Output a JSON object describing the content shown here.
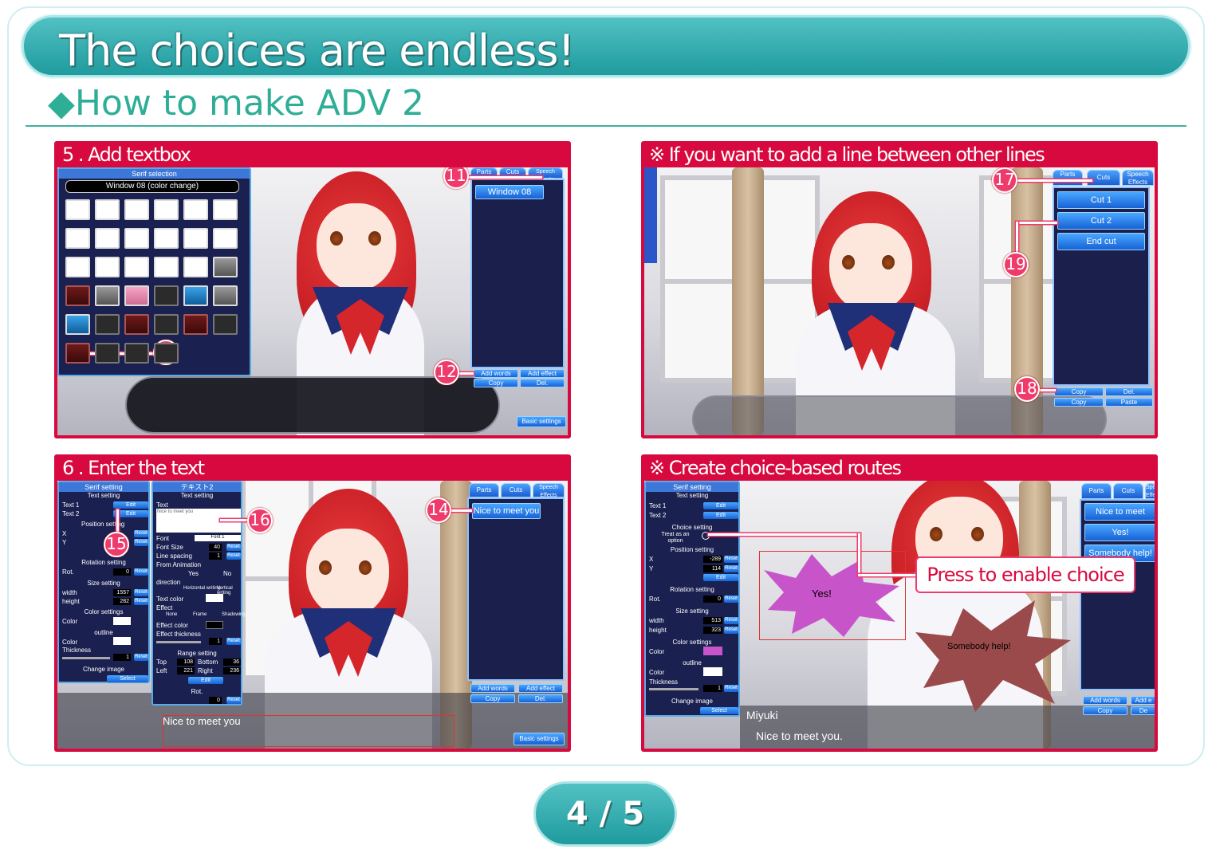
{
  "banner": {
    "title": "The choices are endless!"
  },
  "subheading": "◆How to make ADV 2",
  "panels": {
    "p1": {
      "title": "5 . Add textbox",
      "selector_header": "Serif selection",
      "window_name": "Window 08 (color change)",
      "list_item": "Window 08",
      "tabs": [
        "Parts",
        "Cuts",
        "Speech Effects"
      ],
      "buttons": {
        "add_words": "Add words",
        "add_effect": "Add effect",
        "copy": "Copy",
        "del": "Del.",
        "basic": "Basic settings"
      },
      "callouts": [
        "11",
        "12",
        "13"
      ]
    },
    "p2": {
      "title": "※ If you want to add a line between other lines",
      "tabs": [
        "Parts",
        "Cuts",
        "Speech Effects"
      ],
      "list": [
        "Cut 1",
        "Cut 2",
        "End cut"
      ],
      "buttons": {
        "copy": "Copy",
        "del": "Del.",
        "copy2": "Copy",
        "paste": "Paste"
      },
      "callouts": [
        "17",
        "18",
        "19"
      ]
    },
    "p3": {
      "title": "6 . Enter the text",
      "serif_header": "Serif setting",
      "text2_header": "テキスト2",
      "text_setting": "Text setting",
      "text1": "Text 1",
      "text2": "Text 2",
      "edit": "Edit",
      "reset": "Reset",
      "select": "Select",
      "position": "Position setting",
      "x": "X",
      "y": "Y",
      "rotation": "Rotation setting",
      "rot": "Rot.",
      "size": "Size setting",
      "width": "width",
      "height": "height",
      "width_val": "1557",
      "height_val": "282",
      "color_settings": "Color settings",
      "color": "Color",
      "outline": "outline",
      "thickness": "Thickness",
      "change_image": "Change image",
      "text_label": "Text",
      "text_value": "Nice to meet you",
      "font": "Font",
      "font_value": "Font 1",
      "font_size": "Font Size",
      "font_size_val": "40",
      "line_spacing": "Line spacing",
      "line_spacing_val": "1",
      "from_animation": "From Animation",
      "yes": "Yes",
      "no": "No",
      "direction": "direction",
      "horizontal": "Horizontal writing",
      "vertical": "Vertical writing",
      "text_color": "Text color",
      "effect": "Effect",
      "none": "None",
      "frame": "Frame",
      "shadowing": "Shadowing",
      "effect_color": "Effect color",
      "effect_thickness": "Effect thickness",
      "effect_thickness_val": "1",
      "range": "Range setting",
      "top": "Top",
      "top_val": "108",
      "bottom": "Bottom",
      "bottom_val": "36",
      "left": "Left",
      "left_val": "221",
      "right": "Right",
      "right_val": "236",
      "rot_val": "0",
      "thickness_val": "1",
      "tabs": [
        "Parts",
        "Cuts",
        "Speech Effects"
      ],
      "list_item": "Nice to meet you",
      "buttons": {
        "add_words": "Add words",
        "add_effect": "Add effect",
        "copy": "Copy",
        "del": "Del.",
        "basic": "Basic settings"
      },
      "speaker": "???",
      "dialog": "Nice to meet you",
      "callouts": [
        "14",
        "15",
        "16"
      ]
    },
    "p4": {
      "title": "※ Create choice-based routes",
      "serif_header": "Serif setting",
      "text_setting": "Text setting",
      "text1": "Text 1",
      "text2": "Text 2",
      "edit": "Edit",
      "choice_setting": "Choice setting",
      "treat_as_option": "Treat as an option",
      "position": "Position setting",
      "x": "X",
      "y": "Y",
      "x_val": "-289",
      "y_val": "114",
      "rotation": "Rotation setting",
      "rot": "Rot.",
      "rot_val": "0",
      "size": "Size setting",
      "width": "width",
      "height": "height",
      "width_val": "513",
      "height_val": "323",
      "color_settings": "Color settings",
      "color": "Color",
      "outline": "outline",
      "thickness": "Thickness",
      "thickness_val": "1",
      "change_image": "Change image",
      "select": "Select",
      "reset": "Reset",
      "tabs": [
        "Parts",
        "Cuts",
        "Speech Effects"
      ],
      "list": [
        "Nice to meet",
        "Yes!",
        "Somebody help!"
      ],
      "buttons": {
        "add_words": "Add words",
        "add_effect": "Add e",
        "copy": "Copy",
        "del": "De"
      },
      "bubble_yes": "Yes!",
      "bubble_help": "Somebody help!",
      "choice_label": "Press to enable choice",
      "speaker": "Miyuki",
      "dialog": "Nice to meet you."
    }
  },
  "pager": {
    "text": "4 / 5"
  },
  "colors": {
    "teal": "#1f9b9e",
    "crimson": "#d8093f",
    "callout": "#ef3b6b",
    "ui_blue": "#1762d6"
  }
}
